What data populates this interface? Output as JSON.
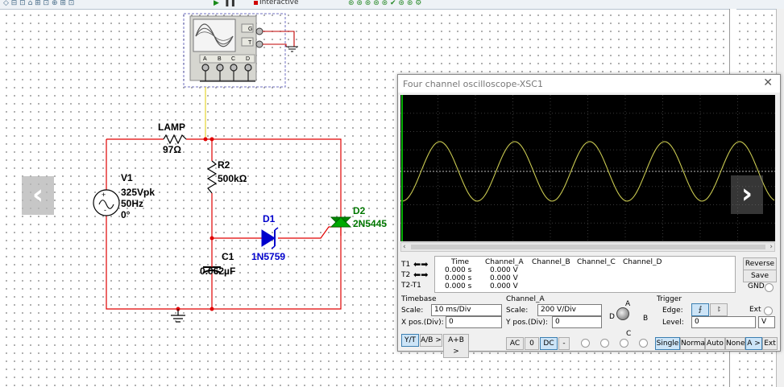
{
  "toolbar": {
    "mode_label": "Interactive"
  },
  "circuit": {
    "lamp": {
      "name": "LAMP",
      "value": "97Ω"
    },
    "source": {
      "name": "V1",
      "voltage": "325Vpk",
      "frequency": "50Hz",
      "phase": "0°"
    },
    "r2": {
      "name": "R2",
      "value": "500kΩ"
    },
    "d1": {
      "name": "D1",
      "part": "1N5759"
    },
    "d2": {
      "name": "D2",
      "part": "2N5445"
    },
    "c1": {
      "name": "C1",
      "value": "0.062µF"
    },
    "scope_terminals": {
      "g": "G",
      "t": "T",
      "a": "A",
      "b": "B",
      "c": "C",
      "d": "D"
    }
  },
  "colors": {
    "wire": "#e00000",
    "probe": "#ffe066",
    "d1": "#0000cc",
    "d2": "#007700",
    "trace": "#c8c850"
  },
  "oscilloscope": {
    "title": "Four channel oscilloscope-XSC1",
    "readout": {
      "headers": [
        "Time",
        "Channel_A",
        "Channel_B",
        "Channel_C",
        "Channel_D"
      ],
      "rows": [
        {
          "label": "T1",
          "time": "0.000 s",
          "channel_a": "0.000 V"
        },
        {
          "label": "T2",
          "time": "0.000 s",
          "channel_a": "0.000 V"
        },
        {
          "label": "T2-T1",
          "time": "0.000 s",
          "channel_a": "0.000 V"
        }
      ]
    },
    "side_buttons": {
      "reverse": "Reverse",
      "save": "Save",
      "gnd": "GND"
    },
    "timebase": {
      "title": "Timebase",
      "scale_label": "Scale:",
      "scale_value": "10 ms/Div",
      "xpos_label": "X pos.(Div):",
      "xpos_value": "0",
      "modes": [
        "Y/T",
        "A/B >",
        "A+B >"
      ]
    },
    "channel": {
      "title": "Channel_A",
      "scale_label": "Scale:",
      "scale_value": "200  V/Div",
      "ypos_label": "Y pos.(Div):",
      "ypos_value": "0",
      "coupling": [
        "AC",
        "0",
        "DC",
        "-"
      ],
      "knob_labels": {
        "a": "A",
        "b": "B",
        "c": "C",
        "d": "D"
      }
    },
    "trigger": {
      "title": "Trigger",
      "edge_label": "Edge:",
      "ext_label": "Ext",
      "level_label": "Level:",
      "level_value": "0",
      "level_unit": "V",
      "modes": [
        "Single",
        "Normal",
        "Auto",
        "None",
        "A >",
        "Ext"
      ]
    }
  }
}
